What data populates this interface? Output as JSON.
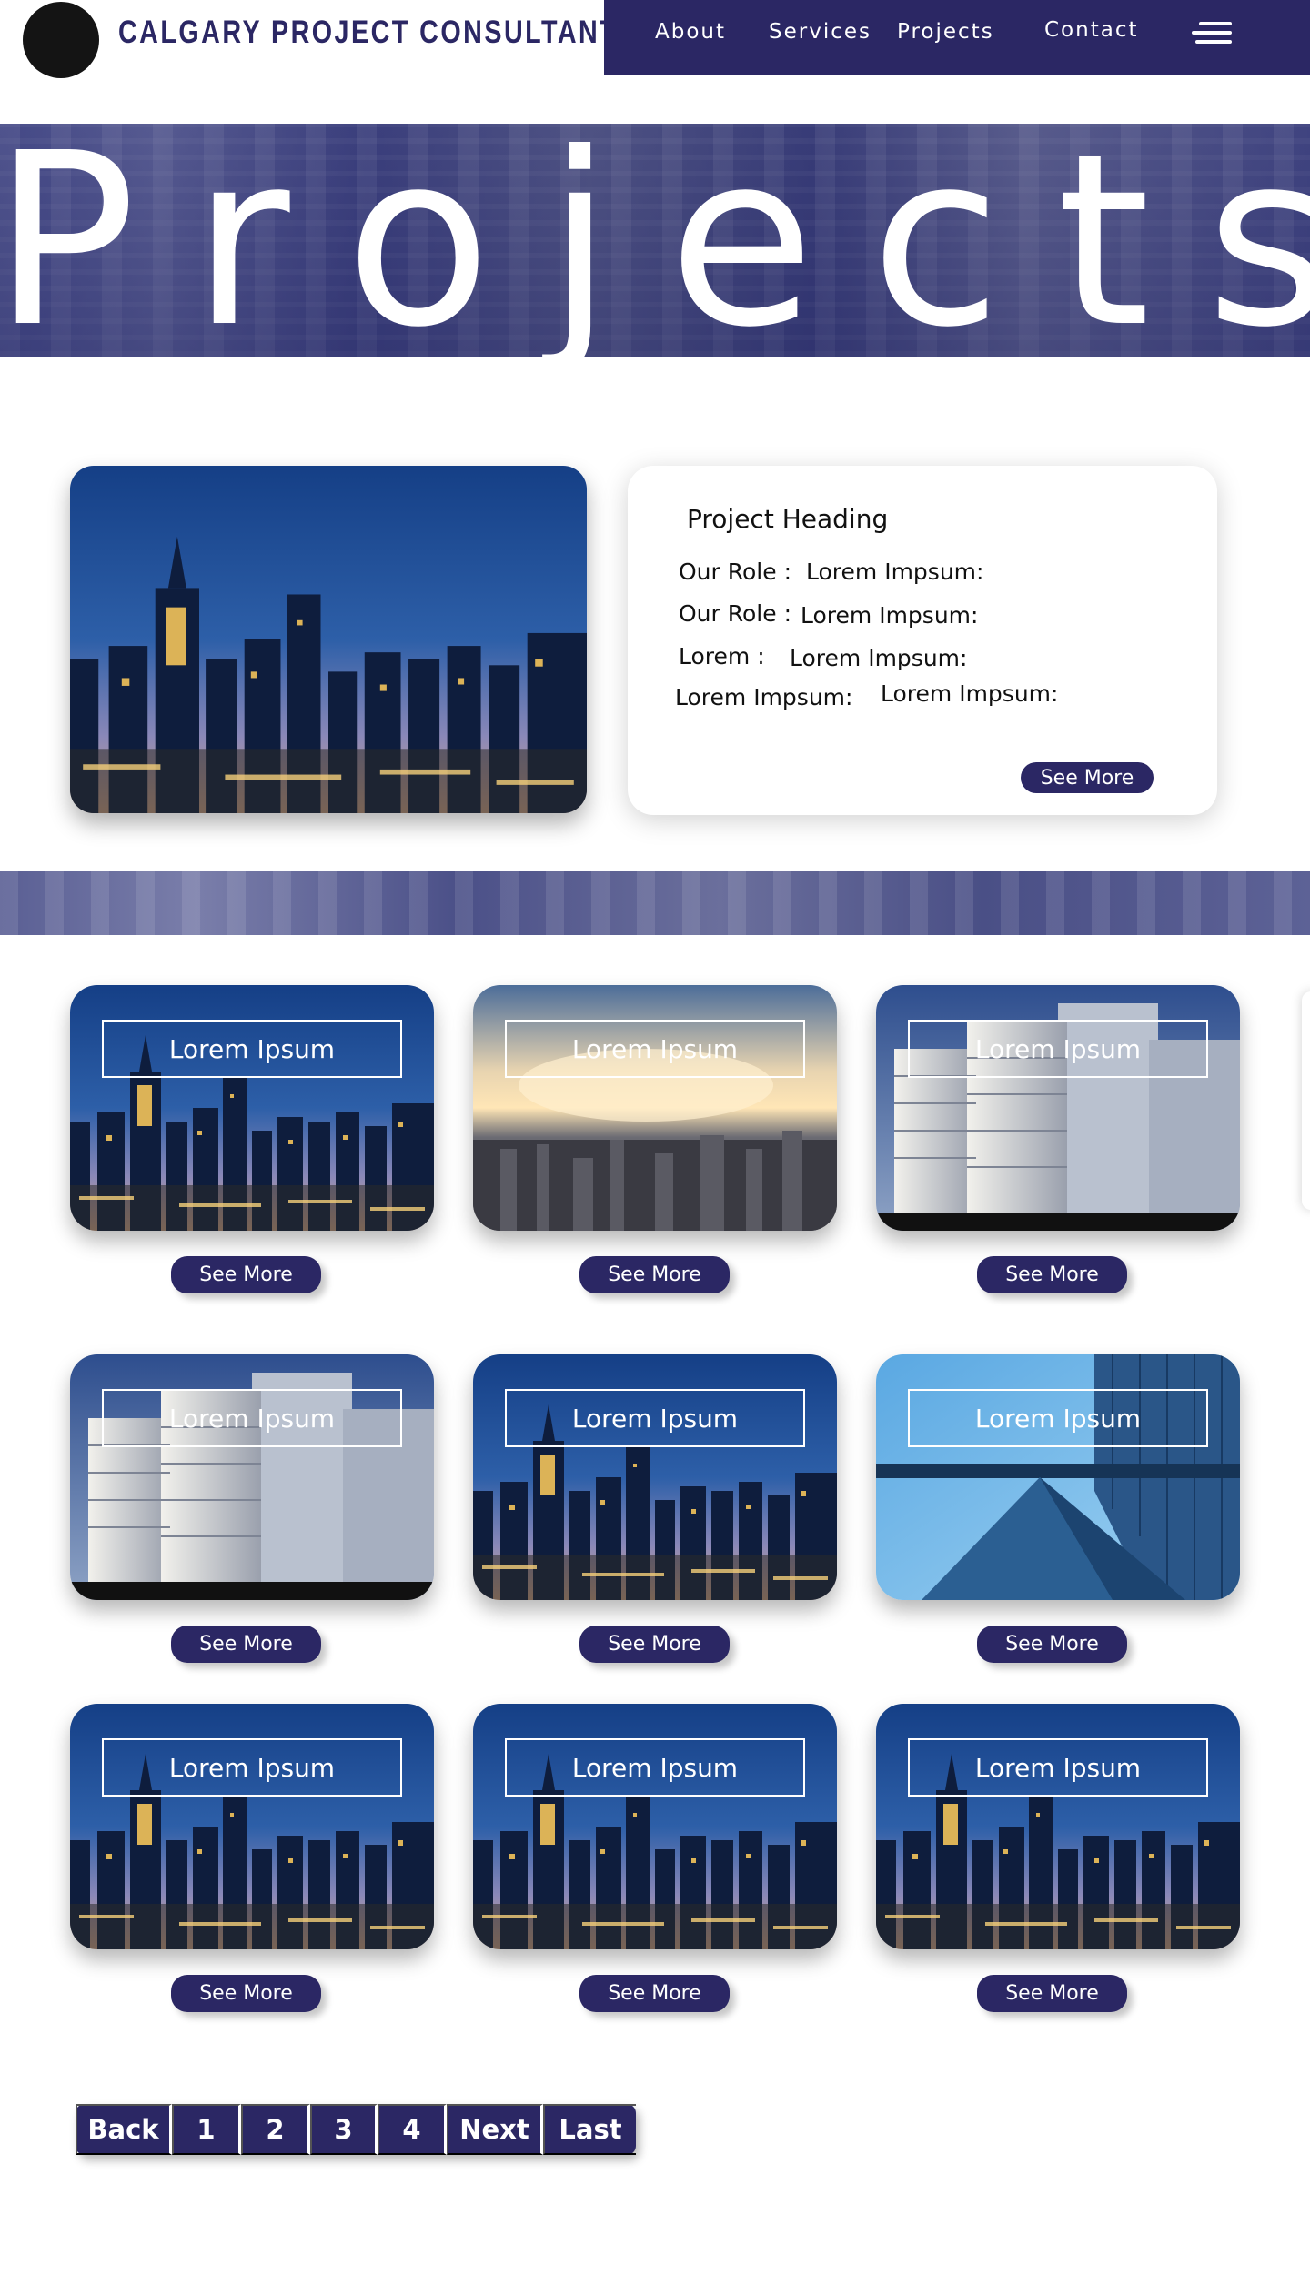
{
  "header": {
    "brand": "CALGARY PROJECT CONSULTANTS",
    "nav": [
      {
        "label": "About"
      },
      {
        "label": "Services"
      },
      {
        "label": "Projects"
      },
      {
        "label": "Contact"
      }
    ],
    "menu_icon": "hamburger-icon"
  },
  "hero": {
    "title_letters": [
      "P",
      "r",
      "o",
      "j",
      "e",
      "c",
      "t",
      "s"
    ]
  },
  "featured": {
    "photo": "city-skyline-night",
    "heading": "Project Heading",
    "rows": [
      {
        "label": "Our Role :",
        "value": "Lorem Impsum:"
      },
      {
        "label": "Our Role :",
        "value": "Lorem Impsum:"
      },
      {
        "label": "Lorem :",
        "value": "Lorem Impsum:"
      },
      {
        "label": "Lorem Impsum:",
        "value": "Lorem Impsum:"
      }
    ],
    "button": "See More"
  },
  "grid": {
    "button": "See More",
    "tiles": [
      {
        "label": "Lorem Ipsum",
        "photo": "city-skyline-night"
      },
      {
        "label": "Lorem Ipsum",
        "photo": "city-sunset-aerial"
      },
      {
        "label": "Lorem Ipsum",
        "photo": "office-towers"
      },
      {
        "label": "Lorem Ipsum",
        "photo": "office-towers"
      },
      {
        "label": "Lorem Ipsum",
        "photo": "city-skyline-night"
      },
      {
        "label": "Lorem Ipsum",
        "photo": "glass-building-sky"
      },
      {
        "label": "Lorem Ipsum",
        "photo": "city-skyline-night"
      },
      {
        "label": "Lorem Ipsum",
        "photo": "city-skyline-night"
      },
      {
        "label": "Lorem Ipsum",
        "photo": "city-skyline-night"
      }
    ]
  },
  "pagination": [
    "Back",
    "1",
    "2",
    "3",
    "4",
    "Next",
    "Last"
  ],
  "colors": {
    "brand": "#2b2764",
    "accent_white": "#ffffff"
  }
}
